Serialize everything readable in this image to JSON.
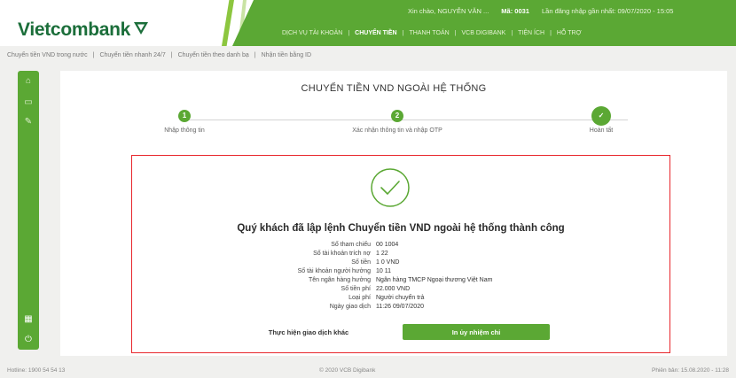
{
  "brand": {
    "name": "Vietcombank",
    "color": "#1b6e3a",
    "accent": "#5ba834",
    "alert_border": "#e8252b"
  },
  "header": {
    "user": [
      "Xin chào, NGUYỄN VĂN ...",
      "Mã: 0031",
      "Lần đăng nhập gần nhất: 09/07/2020 - 15:05"
    ],
    "nav": [
      "DỊCH VỤ TÀI KHOẢN",
      "CHUYỂN TIỀN",
      "THANH TOÁN",
      "VCB DIGIBANK",
      "TIỆN ÍCH",
      "HỖ TRỢ"
    ],
    "active_nav": 1
  },
  "breadcrumb": [
    "Chuyển tiền VND trong nước",
    "Chuyển tiền nhanh 24/7",
    "Chuyển tiền theo danh bạ",
    "Nhận tiền bằng ID"
  ],
  "sidebar": {
    "icons": [
      "home-icon",
      "card-icon",
      "settings-icon",
      "flag-icon",
      "power-icon"
    ]
  },
  "page_title": "CHUYỂN TIỀN VND NGOÀI HỆ THỐNG",
  "steps": [
    {
      "num": "1",
      "label": "Nhập thông tin"
    },
    {
      "num": "2",
      "label": "Xác nhận thông tin và nhập OTP"
    },
    {
      "num": "✓",
      "label": "Hoàn tất"
    }
  ],
  "success": {
    "message": "Quý khách đã lập lệnh Chuyển tiền VND ngoài hệ thống thành công",
    "rows": [
      {
        "label": "Số tham chiếu",
        "value": "00     1004"
      },
      {
        "label": "Số tài khoản trích nợ",
        "value": "1     22"
      },
      {
        "label": "Số tiền",
        "value": "1     0 VND"
      },
      {
        "label": "Số tài khoản người hưởng",
        "value": "10     11"
      },
      {
        "label": "Tên ngân hàng hưởng",
        "value": "Ngân hàng TMCP Ngoại thương Việt Nam"
      },
      {
        "label": "Số tiền phí",
        "value": "22.000 VND"
      },
      {
        "label": "Loại phí",
        "value": "Người chuyển trả"
      },
      {
        "label": "Ngày giao dịch",
        "value": "11:26 09/07/2020"
      }
    ]
  },
  "actions": {
    "secondary": "Thực hiện giao dịch khác",
    "primary": "In ủy nhiệm chi"
  },
  "footer": {
    "left": "Hotline: 1900 54 54 13",
    "mid": "© 2020 VCB Digibank",
    "right": "Phiên bản: 15.08.2020 - 11:28"
  }
}
